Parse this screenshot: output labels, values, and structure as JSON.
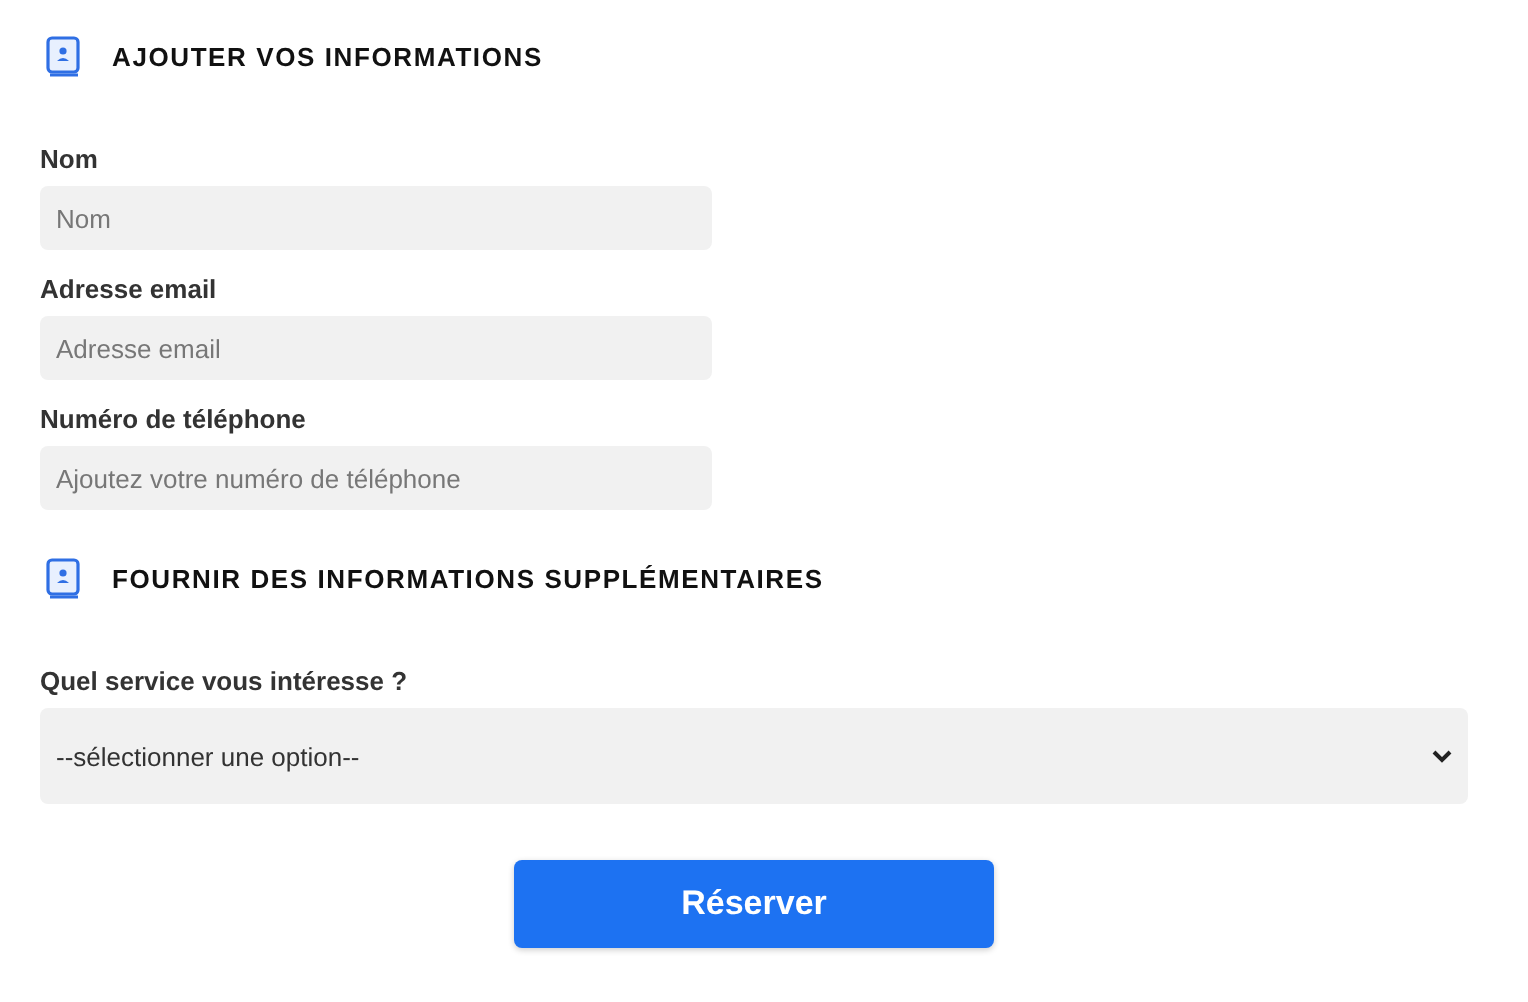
{
  "sections": [
    {
      "title": "AJOUTER VOS INFORMATIONS",
      "fields": [
        {
          "kind": "input",
          "label": "Nom",
          "placeholder": "Nom"
        },
        {
          "kind": "input",
          "label": "Adresse email",
          "placeholder": "Adresse email"
        },
        {
          "kind": "input",
          "label": "Numéro de téléphone",
          "placeholder": "Ajoutez votre numéro de téléphone"
        }
      ]
    },
    {
      "title": "FOURNIR DES INFORMATIONS SUPPLÉMENTAIRES",
      "fields": [
        {
          "kind": "select",
          "label": "Quel service vous intéresse ?",
          "value": "--sélectionner une option--"
        }
      ]
    }
  ],
  "submit": {
    "label": "Réserver"
  }
}
